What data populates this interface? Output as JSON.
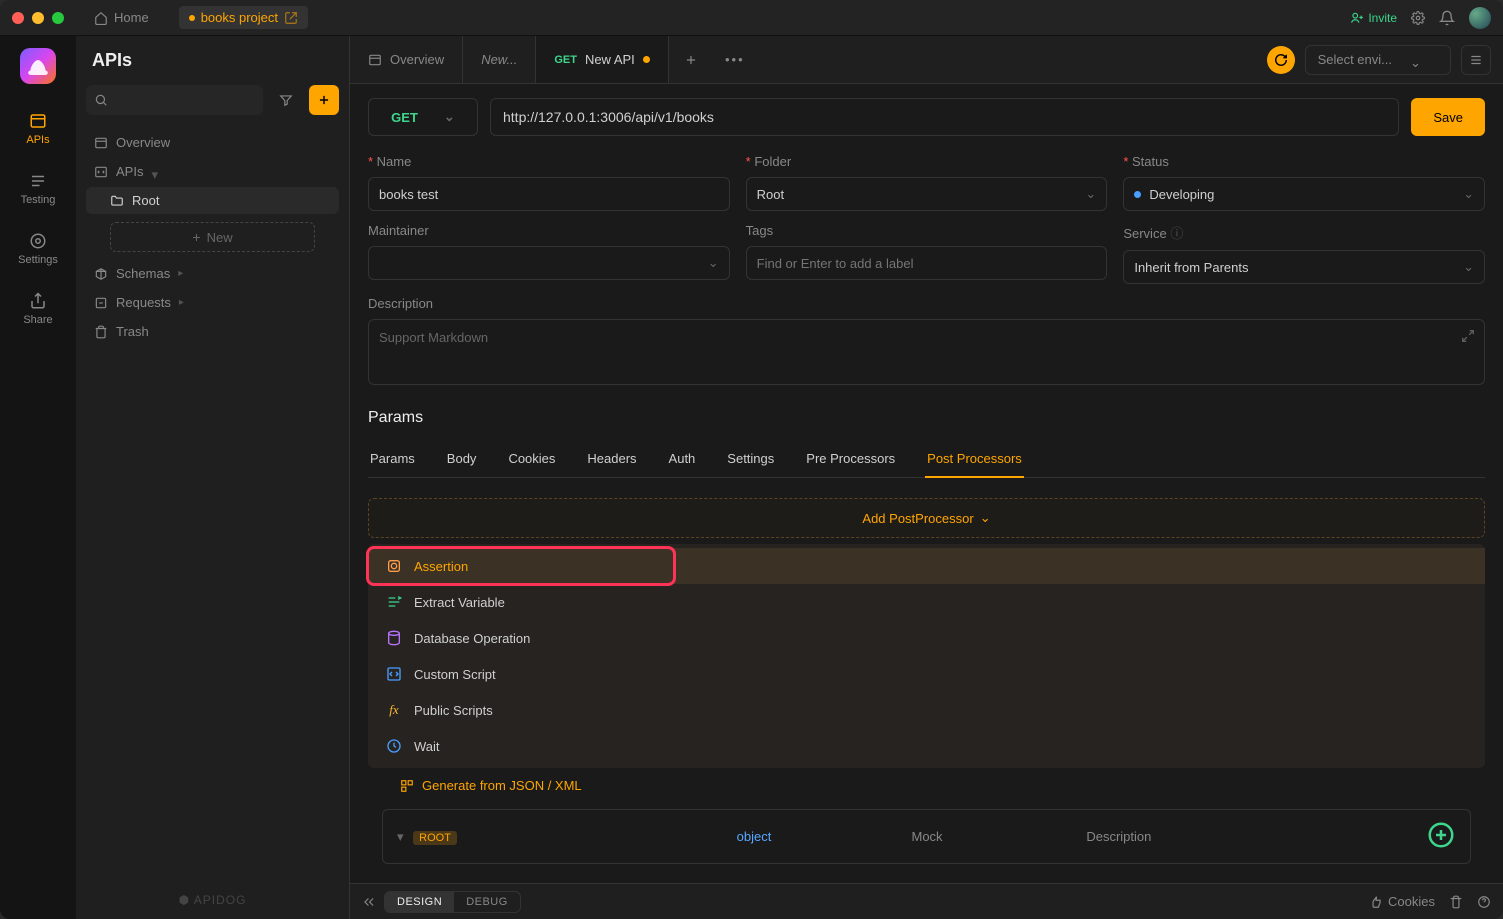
{
  "titlebar": {
    "home": "Home",
    "project": "books project",
    "invite": "Invite"
  },
  "rail": {
    "apis": "APIs",
    "testing": "Testing",
    "settings": "Settings",
    "share": "Share"
  },
  "sidebar": {
    "title": "APIs",
    "overview": "Overview",
    "apis": "APIs",
    "root": "Root",
    "new": "New",
    "schemas": "Schemas",
    "requests": "Requests",
    "trash": "Trash",
    "footer": "⬢ APIDOG"
  },
  "tabs": {
    "overview": "Overview",
    "new": "New...",
    "active_method": "GET",
    "active_label": "New API",
    "env": "Select envi..."
  },
  "request": {
    "method": "GET",
    "url": "http://127.0.0.1:3006/api/v1/books",
    "save": "Save"
  },
  "form": {
    "name_label": "Name",
    "name_value": "books test",
    "folder_label": "Folder",
    "folder_value": "Root",
    "status_label": "Status",
    "status_value": "Developing",
    "maintainer_label": "Maintainer",
    "tags_label": "Tags",
    "tags_placeholder": "Find or Enter to add a label",
    "service_label": "Service",
    "service_value": "Inherit from Parents",
    "desc_label": "Description",
    "desc_placeholder": "Support Markdown"
  },
  "params": {
    "section": "Params",
    "tabs": [
      "Params",
      "Body",
      "Cookies",
      "Headers",
      "Auth",
      "Settings",
      "Pre Processors",
      "Post Processors"
    ],
    "active_tab_index": 7,
    "add_label": "Add PostProcessor"
  },
  "menu": {
    "items": [
      {
        "icon": "assertion",
        "label": "Assertion",
        "hl": true
      },
      {
        "icon": "extract",
        "label": "Extract Variable"
      },
      {
        "icon": "db",
        "label": "Database Operation"
      },
      {
        "icon": "script",
        "label": "Custom Script"
      },
      {
        "icon": "fx",
        "label": "Public Scripts"
      },
      {
        "icon": "clock",
        "label": "Wait"
      }
    ]
  },
  "below": {
    "generate": "Generate from JSON / XML",
    "root": "ROOT",
    "type": "object",
    "mock": "Mock",
    "desc": "Description"
  },
  "status": {
    "design": "DESIGN",
    "debug": "DEBUG",
    "cookies": "Cookies"
  }
}
